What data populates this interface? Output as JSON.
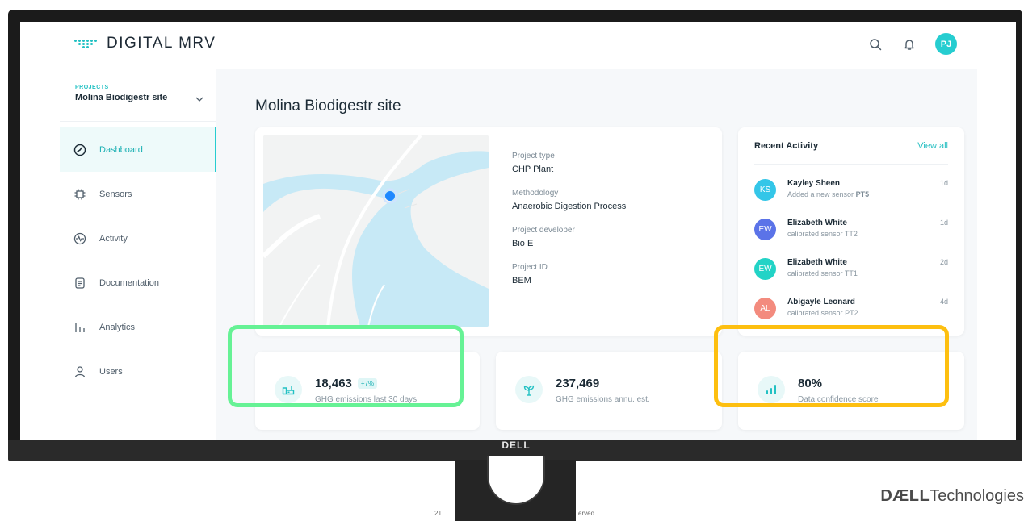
{
  "app": {
    "logo_text": "DIGITAL MRV",
    "user_initials": "PJ"
  },
  "icons": {
    "search": "search-icon",
    "bell": "bell-icon",
    "chevron": "chevron-down-icon"
  },
  "sidebar": {
    "project_caption": "PROJECTS",
    "project_name": "Molina Biodigestr site",
    "items": [
      {
        "label": "Dashboard",
        "icon": "gauge-icon",
        "active": true
      },
      {
        "label": "Sensors",
        "icon": "chip-icon",
        "active": false
      },
      {
        "label": "Activity",
        "icon": "pulse-icon",
        "active": false
      },
      {
        "label": "Documentation",
        "icon": "document-icon",
        "active": false
      },
      {
        "label": "Analytics",
        "icon": "bar-chart-icon",
        "active": false
      },
      {
        "label": "Users",
        "icon": "user-icon",
        "active": false
      }
    ]
  },
  "main": {
    "page_title": "Molina Biodigestr site",
    "project": {
      "fields": [
        {
          "label": "Project type",
          "value": "CHP Plant"
        },
        {
          "label": "Methodology",
          "value": "Anaerobic Digestion Process"
        },
        {
          "label": "Project developer",
          "value": "Bio E"
        },
        {
          "label": "Project ID",
          "value": "BEM"
        }
      ]
    },
    "activity": {
      "title": "Recent Activity",
      "view_all": "View all",
      "items": [
        {
          "initials": "KS",
          "color": "#34c6e8",
          "name": "Kayley Sheen",
          "action": "Added a new sensor",
          "sensor": "PT5",
          "time": "1d"
        },
        {
          "initials": "EW",
          "color": "#5b73e8",
          "name": "Elizabeth White",
          "action": "calibrated sensor",
          "sensor": "TT2",
          "time": "1d"
        },
        {
          "initials": "EW",
          "color": "#22d3c6",
          "name": "Elizabeth White",
          "action": "calibrated sensor",
          "sensor": "TT1",
          "time": "2d"
        },
        {
          "initials": "AL",
          "color": "#f38b7e",
          "name": "Abigayle Leonard",
          "action": "calibrated sensor",
          "sensor": "PT2",
          "time": "4d"
        }
      ]
    },
    "stats": [
      {
        "value": "18,463",
        "badge": "+7%",
        "label": "GHG emissions last 30 days",
        "icon": "factory-icon"
      },
      {
        "value": "237,469",
        "badge": "",
        "label": "GHG emissions annu. est.",
        "icon": "plant-icon"
      },
      {
        "value": "80%",
        "badge": "",
        "label": "Data confidence score",
        "icon": "signal-bars-icon"
      }
    ]
  },
  "frame": {
    "bezel_brand": "DELL",
    "slide_number": "21",
    "slide_footer_fragment": "erved.",
    "company_logo_bold": "DÆLL",
    "company_logo_rest": "Technologies"
  },
  "colors": {
    "accent": "#26cdd0",
    "highlight_green": "#66f295",
    "highlight_yellow": "#fdbf10"
  }
}
